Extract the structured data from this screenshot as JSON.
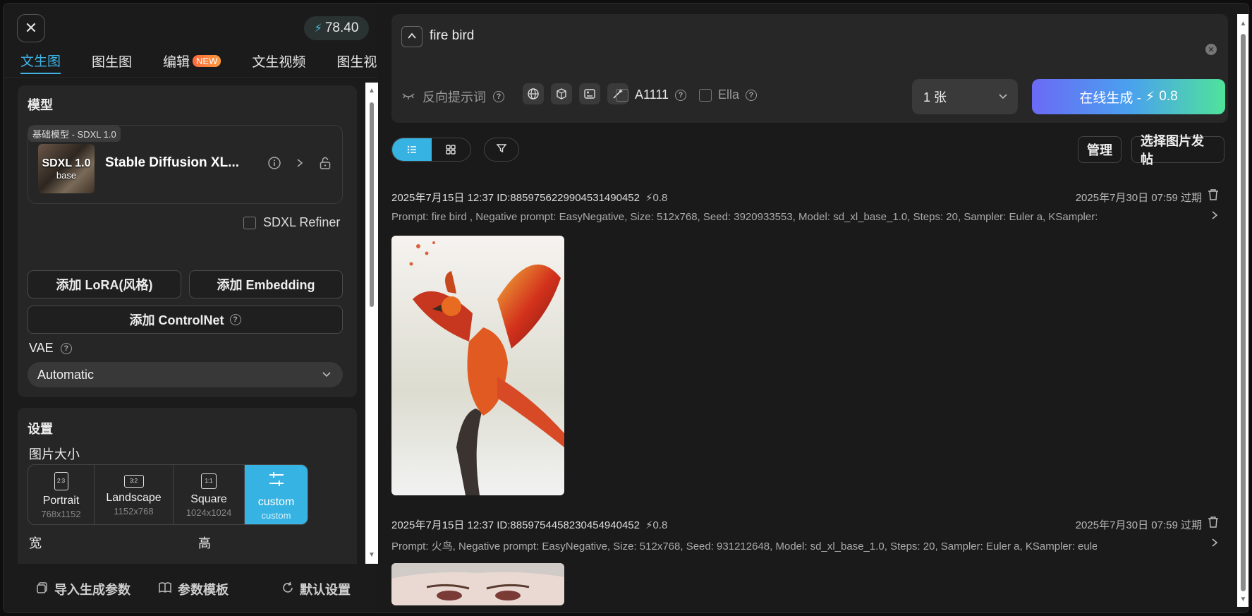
{
  "credits": {
    "value": "78.40",
    "icon": "bolt-icon"
  },
  "tabs": [
    {
      "label": "文生图",
      "active": true
    },
    {
      "label": "图生图"
    },
    {
      "label": "编辑",
      "badge": "NEW"
    },
    {
      "label": "文生视频"
    },
    {
      "label": "图生视频"
    }
  ],
  "model": {
    "section_title": "模型",
    "tag": "基础模型 - SDXL 1.0",
    "thumb_title": "SDXL 1.0",
    "thumb_sub": "base",
    "name": "Stable Diffusion XL..."
  },
  "refiner_label": "SDXL Refiner",
  "buttons": {
    "add_lora": "添加 LoRA(风格)",
    "add_embedding": "添加 Embedding",
    "add_controlnet": "添加 ControlNet"
  },
  "vae": {
    "label": "VAE",
    "value": "Automatic"
  },
  "settings": {
    "section_title": "设置",
    "size_label": "图片大小",
    "sizes": [
      {
        "icon": "2:3",
        "name": "Portrait",
        "dim": "768x1152"
      },
      {
        "icon": "3:2",
        "name": "Landscape",
        "dim": "1152x768"
      },
      {
        "icon": "1:1",
        "name": "Square",
        "dim": "1024x1024"
      },
      {
        "icon": "",
        "name": "custom",
        "dim": "custom",
        "active": true
      }
    ],
    "width_label": "宽",
    "height_label": "高"
  },
  "bottom": {
    "import": "导入生成参数",
    "template": "参数模板",
    "reset": "默认设置"
  },
  "prompt": {
    "text": "fire bird",
    "negative_label": "反向提示词",
    "a1111": "A1111",
    "ella": "Ella",
    "count": "1 张",
    "generate_label": "在线生成 -",
    "generate_cost": "0.8"
  },
  "toolbar": {
    "manage": "管理",
    "select_post": "选择图片发帖"
  },
  "records": [
    {
      "meta": "2025年7月15日 12:37 ID:885975622990453149045​2",
      "cost": "0.8",
      "expire": "2025年7月30日 07:59 过期",
      "prompt": "Prompt: fire bird , Negative prompt: EasyNegative, Size: 512x768, Seed: 3920933553, Model: sd_xl_base_1.0, Steps: 20, Sampler: Euler a, KSampler:..."
    },
    {
      "meta": "2025年7月15日 12:37 ID:885975445823045494045​2",
      "cost": "0.8",
      "expire": "2025年7月30日 07:59 过期",
      "prompt": "Prompt: 火鸟, Negative prompt: EasyNegative, Size: 512x768, Seed: 931212648, Model: sd_xl_base_1.0, Steps: 20, Sampler: Euler a, KSampler: euler_ancestral,..."
    }
  ]
}
